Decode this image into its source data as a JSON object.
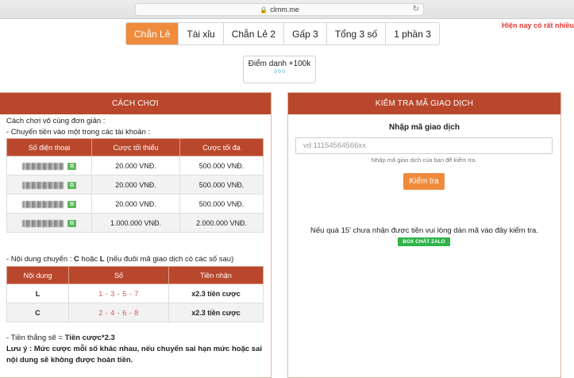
{
  "browser": {
    "url": "clmm.me"
  },
  "marquee": "Hiện nay có rất nhiều",
  "tabs": [
    {
      "label": "Chẵn Lẻ",
      "active": true
    },
    {
      "label": "Tài xỉu"
    },
    {
      "label": "Chẵn Lẻ 2"
    },
    {
      "label": "Gấp 3"
    },
    {
      "label": "Tổng 3 số"
    },
    {
      "label": "1 phần 3"
    }
  ],
  "checkin": {
    "title": "Điểm danh +100k",
    "sub": "0 0 0"
  },
  "left": {
    "header": "CÁCH CHƠI",
    "intro1": "Cách chơi vô cùng đơn giản :",
    "intro2": "- Chuyển tiền vào một trong các tài khoản :",
    "accounts_table": {
      "headers": [
        "Số điện thoại",
        "Cược tối thiểu",
        "Cược tối đa"
      ],
      "rows": [
        {
          "min": "20.000 VNĐ.",
          "max": "500.000 VNĐ."
        },
        {
          "min": "20.000 VNĐ.",
          "max": "500.000 VNĐ."
        },
        {
          "min": "20.000 VNĐ.",
          "max": "500.000 VNĐ."
        },
        {
          "min": "1.000.000 VNĐ.",
          "max": "2.000.000 VNĐ."
        }
      ]
    },
    "content_line_prefix": "- Nội dung chuyển : ",
    "content_line_bold": "C",
    "content_line_mid": " hoặc ",
    "content_line_bold2": "L",
    "content_line_suffix": " (nếu đuôi mã giao dịch có các số sau)",
    "rules_table": {
      "headers": [
        "Nội dung",
        "Số",
        "Tiền nhận"
      ],
      "rows": [
        {
          "content": "L",
          "numbers": "1 - 3 - 5 - 7",
          "reward": "x2.3 tiền cược"
        },
        {
          "content": "C",
          "numbers": "2 - 4 - 6 - 8",
          "reward": "x2.3 tiền cược"
        }
      ]
    },
    "win_prefix": "- Tiền thắng sẽ = ",
    "win_bold": "Tiền cược*2.3",
    "note1": "Lưu ý : Mức cược mỗi số khác nhau, nếu chuyển sai hạn mức hoặc sai",
    "note2": "nội dung sẽ không được hoàn tiền."
  },
  "right": {
    "header": "KIỂM TRA MÃ GIAO DỊCH",
    "title": "Nhập mã giao dịch",
    "input_placeholder": "vd 11154564566xx",
    "hint": "Nhập mã giao dịch của bạn để kiểm tra.",
    "button": "Kiểm tra",
    "note": "Nếu quá 15' chưa nhận được tiền vui lòng dán mã vào đây kiểm tra.",
    "zalo": "BOX CHÁT ZALO"
  },
  "colors": {
    "accent": "#ef8b3c",
    "header": "#b9472c",
    "zalo": "#2fb34a"
  }
}
